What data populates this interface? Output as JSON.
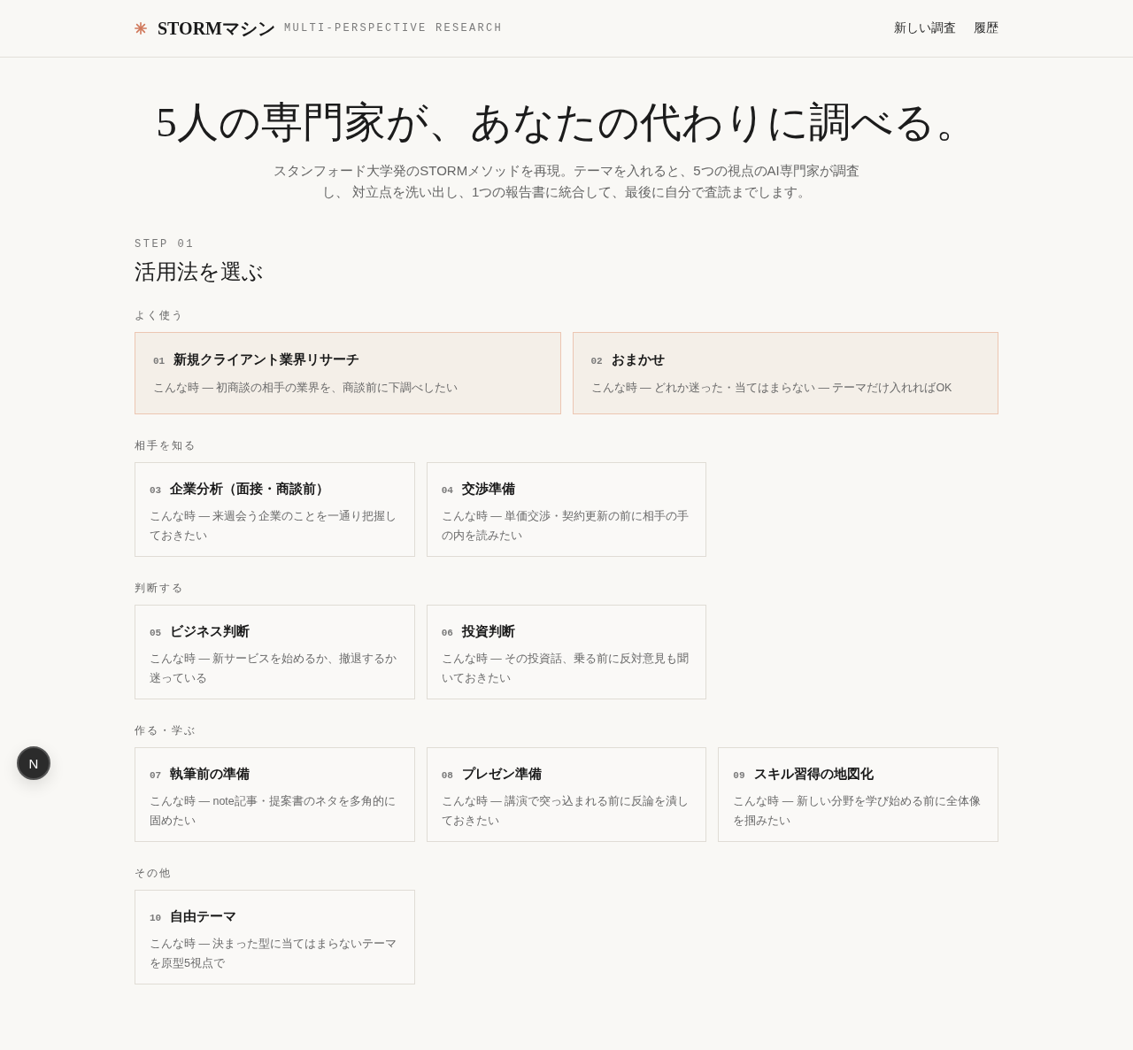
{
  "header": {
    "logo": "STORMマシン",
    "tagline": "MULTI-PERSPECTIVE RESEARCH",
    "nav": [
      {
        "label": "新しい調査"
      },
      {
        "label": "履歴"
      }
    ]
  },
  "hero": {
    "title": "5人の専門家が、あなたの代わりに調べる。",
    "subtitle_lines": [
      "スタンフォード大学発のSTORMメソッドを再現。テーマを入れると、5つの視点のAI専門家が調査",
      "し、 対立点を洗い出し、1つの報告書に統合して、最後に自分で査読までします。"
    ]
  },
  "step": {
    "label": "STEP 01",
    "title": "活用法を選ぶ"
  },
  "groups": [
    {
      "label": "よく使う",
      "kind": "featured",
      "cards": [
        {
          "number": "01",
          "title": "新規クライアント業界リサーチ",
          "description": "こんな時 — 初商談の相手の業界を、商談前に下調べしたい"
        },
        {
          "number": "02",
          "title": "おまかせ",
          "description": "こんな時 — どれか迷った・当てはまらない — テーマだけ入れればOK"
        }
      ]
    },
    {
      "label": "相手を知る",
      "kind": "standard",
      "cards": [
        {
          "number": "03",
          "title": "企業分析（面接・商談前）",
          "description": "こんな時 — 来週会う企業のことを一通り把握しておきたい"
        },
        {
          "number": "04",
          "title": "交渉準備",
          "description": "こんな時 — 単価交渉・契約更新の前に相手の手の内を読みたい"
        }
      ]
    },
    {
      "label": "判断する",
      "kind": "standard",
      "cards": [
        {
          "number": "05",
          "title": "ビジネス判断",
          "description": "こんな時 — 新サービスを始めるか、撤退するか迷っている"
        },
        {
          "number": "06",
          "title": "投資判断",
          "description": "こんな時 — その投資話、乗る前に反対意見も聞いておきたい"
        }
      ]
    },
    {
      "label": "作る・学ぶ",
      "kind": "standard",
      "cards": [
        {
          "number": "07",
          "title": "執筆前の準備",
          "description": "こんな時 — note記事・提案書のネタを多角的に固めたい"
        },
        {
          "number": "08",
          "title": "プレゼン準備",
          "description": "こんな時 — 講演で突っ込まれる前に反論を潰しておきたい"
        },
        {
          "number": "09",
          "title": "スキル習得の地図化",
          "description": "こんな時 — 新しい分野を学び始める前に全体像を掴みたい"
        }
      ]
    },
    {
      "label": "その他",
      "kind": "standard",
      "cards": [
        {
          "number": "10",
          "title": "自由テーマ",
          "description": "こんな時 — 決まった型に当てはまらないテーマを原型5視点で"
        }
      ]
    }
  ],
  "dev_badge": {
    "label": "N"
  }
}
